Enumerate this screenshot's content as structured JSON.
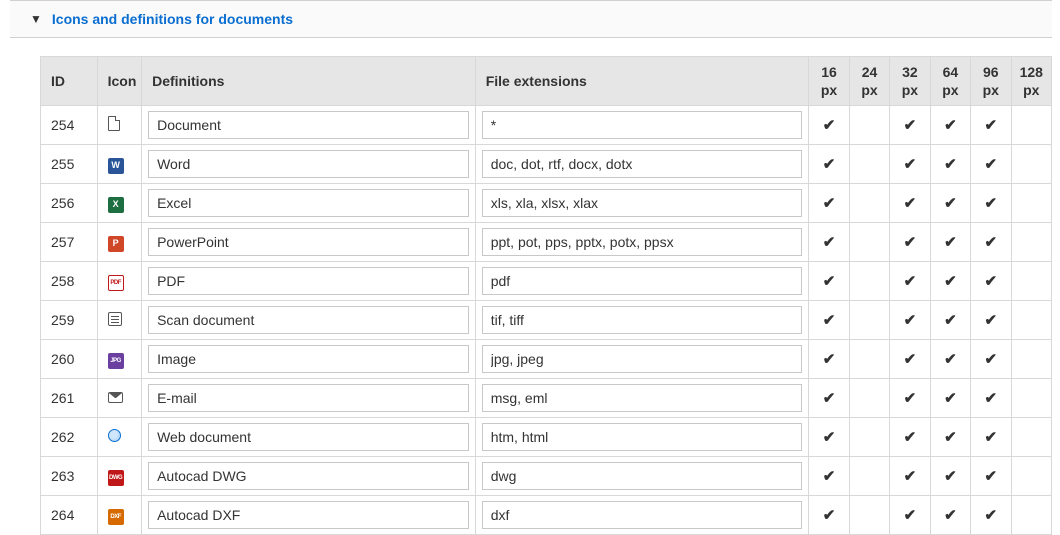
{
  "panel": {
    "title": "Icons and definitions for documents"
  },
  "columns": {
    "id": "ID",
    "icon": "Icon",
    "definitions": "Definitions",
    "extensions": "File extensions",
    "sizes": [
      {
        "num": "16",
        "unit": "px"
      },
      {
        "num": "24",
        "unit": "px"
      },
      {
        "num": "32",
        "unit": "px"
      },
      {
        "num": "64",
        "unit": "px"
      },
      {
        "num": "96",
        "unit": "px"
      },
      {
        "num": "128",
        "unit": "px"
      }
    ]
  },
  "rows": [
    {
      "id": "254",
      "icon": "doc",
      "definition": "Document",
      "extensions": "*",
      "sizes": [
        true,
        false,
        true,
        true,
        true,
        false
      ]
    },
    {
      "id": "255",
      "icon": "word",
      "definition": "Word",
      "extensions": "doc, dot, rtf, docx, dotx",
      "sizes": [
        true,
        false,
        true,
        true,
        true,
        false
      ]
    },
    {
      "id": "256",
      "icon": "excel",
      "definition": "Excel",
      "extensions": "xls, xla, xlsx, xlax",
      "sizes": [
        true,
        false,
        true,
        true,
        true,
        false
      ]
    },
    {
      "id": "257",
      "icon": "ppt",
      "definition": "PowerPoint",
      "extensions": "ppt, pot, pps, pptx, potx, ppsx",
      "sizes": [
        true,
        false,
        true,
        true,
        true,
        false
      ]
    },
    {
      "id": "258",
      "icon": "pdf",
      "definition": "PDF",
      "extensions": "pdf",
      "sizes": [
        true,
        false,
        true,
        true,
        true,
        false
      ]
    },
    {
      "id": "259",
      "icon": "scan",
      "definition": "Scan document",
      "extensions": "tif, tiff",
      "sizes": [
        true,
        false,
        true,
        true,
        true,
        false
      ]
    },
    {
      "id": "260",
      "icon": "img",
      "definition": "Image",
      "extensions": "jpg, jpeg",
      "sizes": [
        true,
        false,
        true,
        true,
        true,
        false
      ]
    },
    {
      "id": "261",
      "icon": "mail",
      "definition": "E-mail",
      "extensions": "msg, eml",
      "sizes": [
        true,
        false,
        true,
        true,
        true,
        false
      ]
    },
    {
      "id": "262",
      "icon": "web",
      "definition": "Web document",
      "extensions": "htm, html",
      "sizes": [
        true,
        false,
        true,
        true,
        true,
        false
      ]
    },
    {
      "id": "263",
      "icon": "dwg",
      "definition": "Autocad DWG",
      "extensions": "dwg",
      "sizes": [
        true,
        false,
        true,
        true,
        true,
        false
      ]
    },
    {
      "id": "264",
      "icon": "dxf",
      "definition": "Autocad DXF",
      "extensions": "dxf",
      "sizes": [
        true,
        false,
        true,
        true,
        true,
        false
      ]
    }
  ]
}
